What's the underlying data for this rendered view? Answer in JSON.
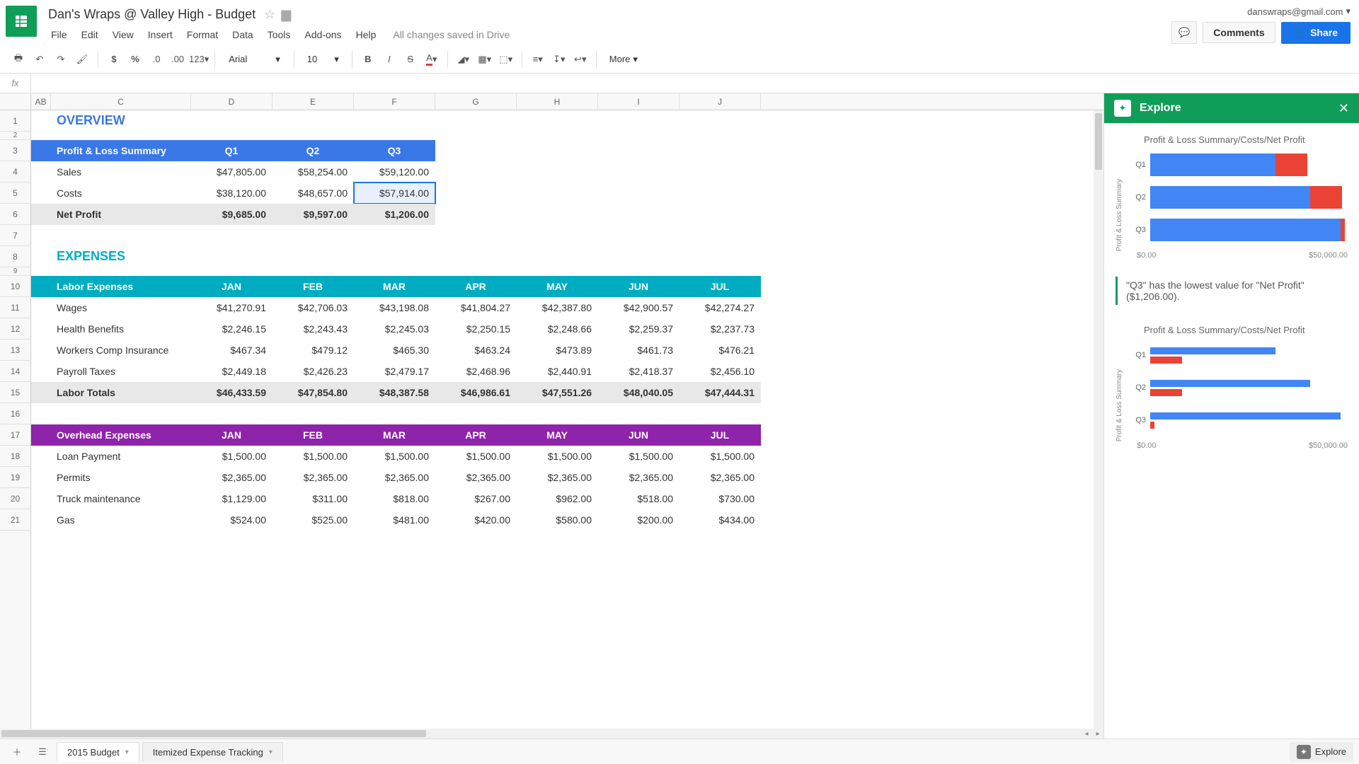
{
  "header": {
    "doc_title": "Dan's Wraps @ Valley High - Budget",
    "account_email": "danswraps@gmail.com",
    "comments_label": "Comments",
    "share_label": "Share",
    "save_status": "All changes saved in Drive"
  },
  "menubar": [
    "File",
    "Edit",
    "View",
    "Insert",
    "Format",
    "Data",
    "Tools",
    "Add-ons",
    "Help"
  ],
  "toolbar": {
    "font": "Arial",
    "size": "10",
    "more_label": "More"
  },
  "columns": [
    "AB",
    "C",
    "D",
    "E",
    "F",
    "G",
    "H",
    "I",
    "J"
  ],
  "row_numbers": [
    "1",
    "2",
    "3",
    "4",
    "5",
    "6",
    "7",
    "8",
    "9",
    "10",
    "11",
    "12",
    "13",
    "14",
    "15",
    "16",
    "17",
    "18",
    "19",
    "20",
    "21"
  ],
  "overview": {
    "title": "OVERVIEW",
    "header": [
      "Profit & Loss Summary",
      "Q1",
      "Q2",
      "Q3"
    ],
    "rows": [
      [
        "Sales",
        "$47,805.00",
        "$58,254.00",
        "$59,120.00"
      ],
      [
        "Costs",
        "$38,120.00",
        "$48,657.00",
        "$57,914.00"
      ]
    ],
    "net": [
      "Net Profit",
      "$9,685.00",
      "$9,597.00",
      "$1,206.00"
    ]
  },
  "expenses": {
    "title": "EXPENSES",
    "labor_header": [
      "Labor Expenses",
      "JAN",
      "FEB",
      "MAR",
      "APR",
      "MAY",
      "JUN",
      "JUL"
    ],
    "labor_rows": [
      [
        "Wages",
        "$41,270.91",
        "$42,706.03",
        "$43,198.08",
        "$41,804.27",
        "$42,387.80",
        "$42,900.57",
        "$42,274.27"
      ],
      [
        "Health Benefits",
        "$2,246.15",
        "$2,243.43",
        "$2,245.03",
        "$2,250.15",
        "$2,248.66",
        "$2,259.37",
        "$2,237.73"
      ],
      [
        "Workers Comp Insurance",
        "$467.34",
        "$479.12",
        "$465.30",
        "$463.24",
        "$473.89",
        "$461.73",
        "$476.21"
      ],
      [
        "Payroll Taxes",
        "$2,449.18",
        "$2,426.23",
        "$2,479.17",
        "$2,468.96",
        "$2,440.91",
        "$2,418.37",
        "$2,456.10"
      ]
    ],
    "labor_totals": [
      "Labor Totals",
      "$46,433.59",
      "$47,854.80",
      "$48,387.58",
      "$46,986.61",
      "$47,551.26",
      "$48,040.05",
      "$47,444.31"
    ],
    "overhead_header": [
      "Overhead Expenses",
      "JAN",
      "FEB",
      "MAR",
      "APR",
      "MAY",
      "JUN",
      "JUL"
    ],
    "overhead_rows": [
      [
        "Loan Payment",
        "$1,500.00",
        "$1,500.00",
        "$1,500.00",
        "$1,500.00",
        "$1,500.00",
        "$1,500.00",
        "$1,500.00"
      ],
      [
        "Permits",
        "$2,365.00",
        "$2,365.00",
        "$2,365.00",
        "$2,365.00",
        "$2,365.00",
        "$2,365.00",
        "$2,365.00"
      ],
      [
        "Truck maintenance",
        "$1,129.00",
        "$311.00",
        "$818.00",
        "$267.00",
        "$962.00",
        "$518.00",
        "$730.00"
      ],
      [
        "Gas",
        "$524.00",
        "$525.00",
        "$481.00",
        "$420.00",
        "$580.00",
        "$200.00",
        "$434.00"
      ]
    ]
  },
  "explore": {
    "title": "Explore",
    "chart1_title": "Profit & Loss Summary/Costs/Net Profit",
    "chart2_title": "Profit & Loss Summary/Costs/Net Profit",
    "ylabel": "Profit & Loss Summary",
    "xaxis": [
      "$0.00",
      "$50,000.00"
    ],
    "insight": "\"Q3\" has the lowest value for \"Net Profit\" ($1,206.00).",
    "bottom_label": "Explore"
  },
  "tabs": {
    "tab1": "2015 Budget",
    "tab2": "Itemized Expense Tracking"
  },
  "chart_data": [
    {
      "type": "bar",
      "orientation": "horizontal",
      "stacked": true,
      "title": "Profit & Loss Summary/Costs/Net Profit",
      "ylabel": "Profit & Loss Summary",
      "xlabel": "",
      "xlim": [
        0,
        60000
      ],
      "categories": [
        "Q1",
        "Q2",
        "Q3"
      ],
      "series": [
        {
          "name": "Costs",
          "values": [
            38120.0,
            48657.0,
            57914.0
          ],
          "color": "#4285f4"
        },
        {
          "name": "Net Profit",
          "values": [
            9685.0,
            9597.0,
            1206.0
          ],
          "color": "#ea4335"
        }
      ]
    },
    {
      "type": "bar",
      "orientation": "horizontal",
      "grouped": true,
      "title": "Profit & Loss Summary/Costs/Net Profit",
      "ylabel": "Profit & Loss Summary",
      "xlabel": "",
      "xlim": [
        0,
        60000
      ],
      "categories": [
        "Q1",
        "Q2",
        "Q3"
      ],
      "series": [
        {
          "name": "Costs",
          "values": [
            38120.0,
            48657.0,
            57914.0
          ],
          "color": "#4285f4"
        },
        {
          "name": "Net Profit",
          "values": [
            9685.0,
            9597.0,
            1206.0
          ],
          "color": "#ea4335"
        }
      ]
    }
  ]
}
